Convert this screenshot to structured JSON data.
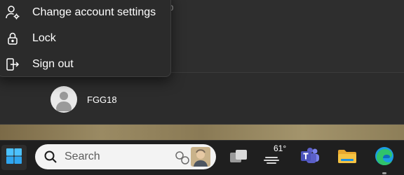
{
  "start_menu": {
    "ghost_text": "pp",
    "user": {
      "name": "FGG18"
    }
  },
  "account_menu": {
    "items": [
      {
        "label": "Change account settings",
        "icon": "account-settings-icon"
      },
      {
        "label": "Lock",
        "icon": "lock-icon"
      },
      {
        "label": "Sign out",
        "icon": "sign-out-icon"
      }
    ]
  },
  "taskbar": {
    "search_label": "Search",
    "weather_temp": "61°",
    "apps": [
      {
        "name": "task-view",
        "icon": "task-view-icon"
      },
      {
        "name": "weather",
        "icon": "weather-icon"
      },
      {
        "name": "teams",
        "icon": "teams-icon"
      },
      {
        "name": "file-explorer",
        "icon": "folder-icon"
      },
      {
        "name": "edge",
        "icon": "edge-icon"
      }
    ]
  },
  "colors": {
    "accent": "#0078d4",
    "menu_background": "#2b2b2b",
    "taskbar_background": "#1f1f1f",
    "teams_purple": "#5b5fc7",
    "folder_yellow": "#f5c343"
  }
}
